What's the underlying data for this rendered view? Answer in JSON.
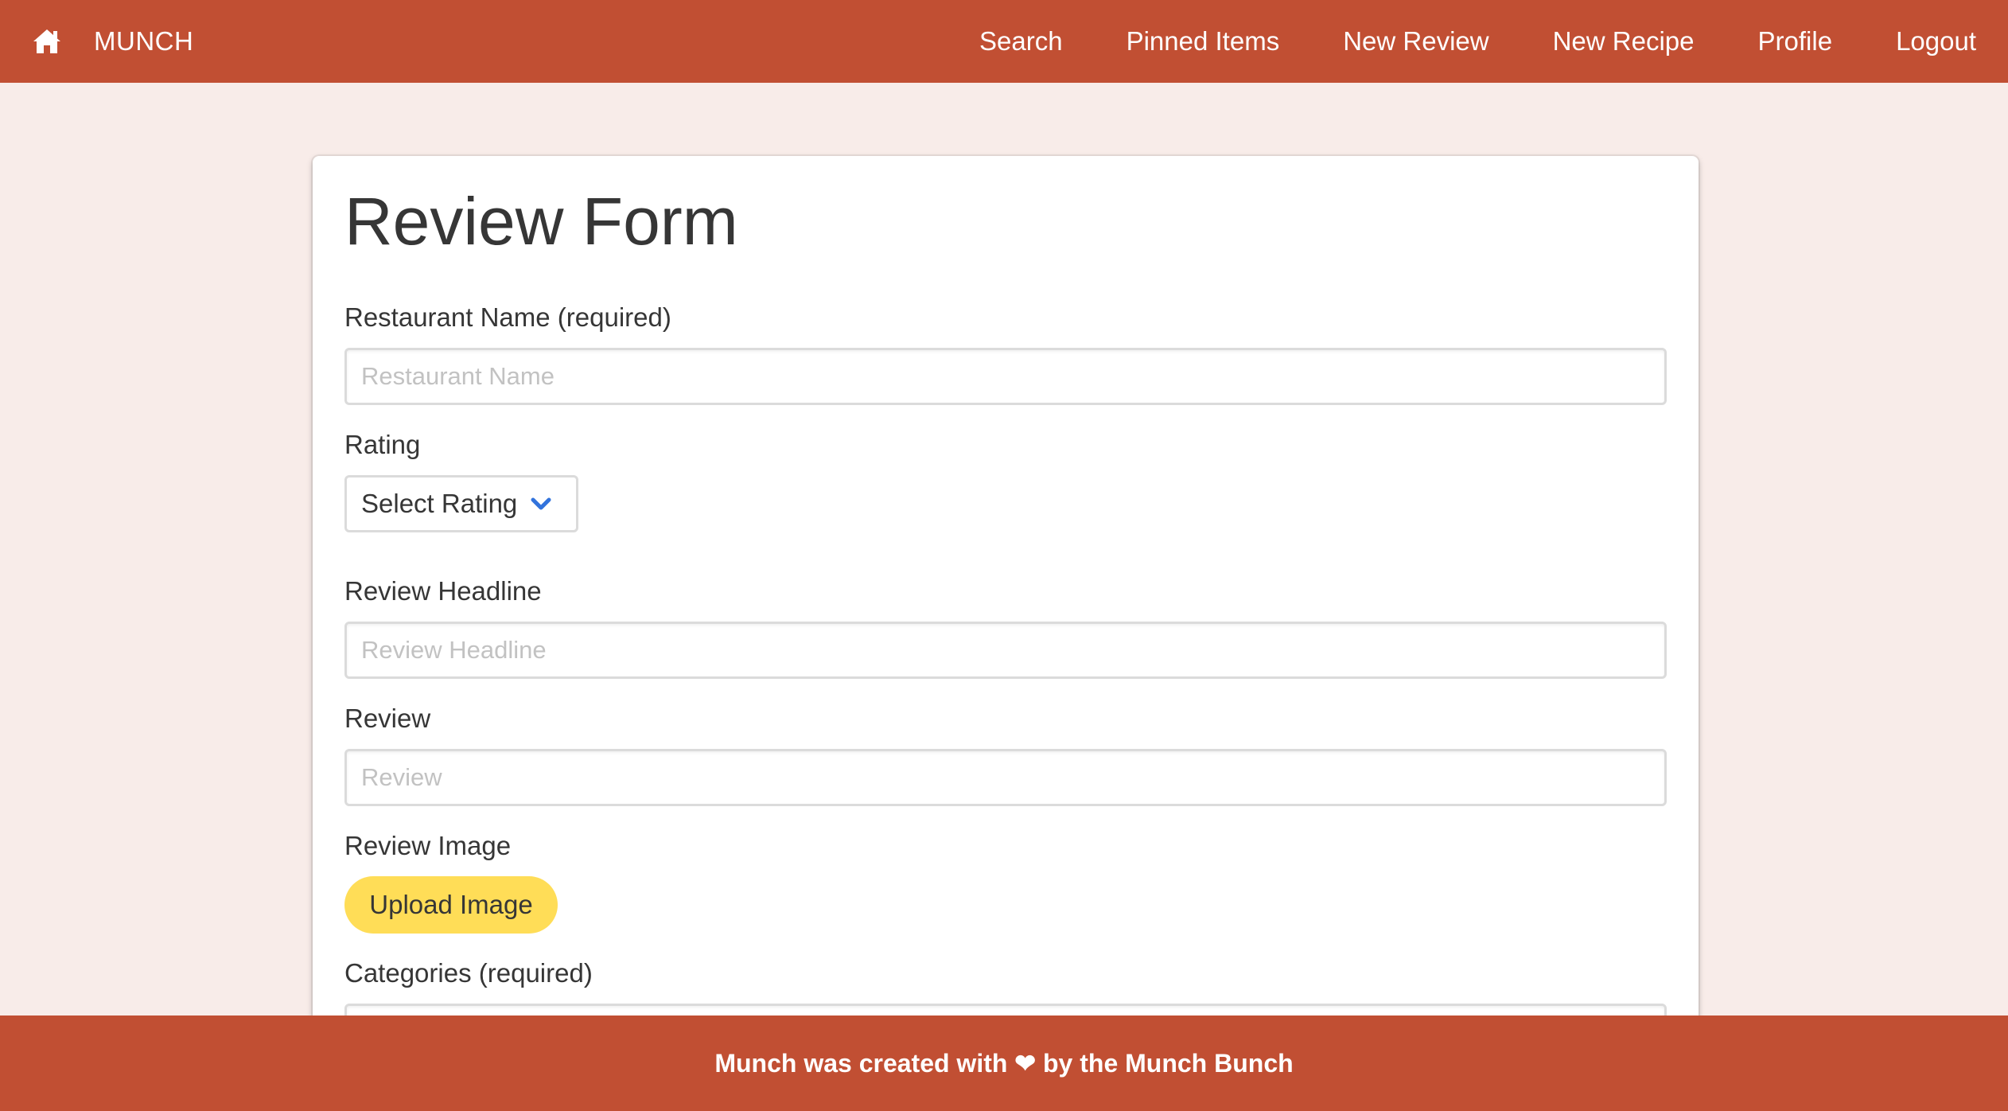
{
  "navbar": {
    "brand": "MUNCH",
    "home_icon": "home-icon",
    "items": [
      {
        "label": "Search"
      },
      {
        "label": "Pinned Items"
      },
      {
        "label": "New Review"
      },
      {
        "label": "New Recipe"
      },
      {
        "label": "Profile"
      },
      {
        "label": "Logout"
      }
    ]
  },
  "form": {
    "title": "Review Form",
    "restaurant": {
      "label": "Restaurant Name (required)",
      "placeholder": "Restaurant Name"
    },
    "rating": {
      "label": "Rating",
      "selected": "Select Rating"
    },
    "headline": {
      "label": "Review Headline",
      "placeholder": "Review Headline"
    },
    "review": {
      "label": "Review",
      "placeholder": "Review"
    },
    "image": {
      "label": "Review Image",
      "button": "Upload Image"
    },
    "categories": {
      "label": "Categories (required)"
    }
  },
  "footer": {
    "before": "Munch was created with ",
    "heart": "❤",
    "after": " by the Munch Bunch"
  },
  "colors": {
    "navbar": "#c14f33",
    "page_bg": "#f8ece9",
    "upload_button": "#ffdd57",
    "chevron": "#3273dc"
  }
}
